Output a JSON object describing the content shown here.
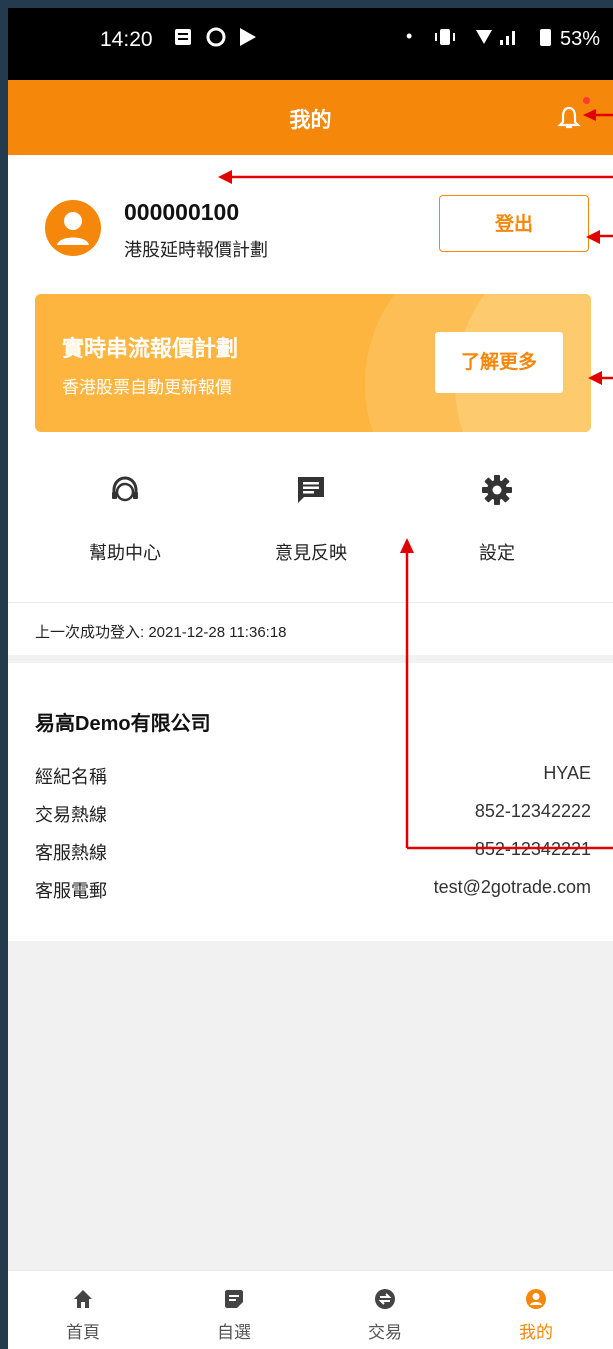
{
  "status_bar": {
    "time": "14:20",
    "battery": "53%"
  },
  "header": {
    "title": "我的"
  },
  "profile": {
    "user_id": "000000100",
    "plan": "港股延時報價計劃",
    "logout_label": "登出"
  },
  "banner": {
    "title": "實時串流報價計劃",
    "subtitle": "香港股票自動更新報價",
    "button_label": "了解更多"
  },
  "shortcuts": [
    {
      "label": "幫助中心",
      "icon": "headset-icon"
    },
    {
      "label": "意見反映",
      "icon": "feedback-icon"
    },
    {
      "label": "設定",
      "icon": "gear-icon"
    }
  ],
  "last_login": "上一次成功登入: 2021-12-28 11:36:18",
  "company": {
    "name": "易高Demo有限公司",
    "rows": [
      {
        "key": "經紀名稱",
        "value": "HYAE"
      },
      {
        "key": "交易熱線",
        "value": "852-12342222"
      },
      {
        "key": "客服熱線",
        "value": "852-12342221"
      },
      {
        "key": "客服電郵",
        "value": "test@2gotrade.com"
      }
    ]
  },
  "bottom_nav": [
    {
      "label": "首頁",
      "icon": "home-icon"
    },
    {
      "label": "自選",
      "icon": "watchlist-icon"
    },
    {
      "label": "交易",
      "icon": "trade-icon"
    },
    {
      "label": "我的",
      "icon": "user-icon",
      "active": true
    }
  ],
  "colors": {
    "accent": "#f5870a",
    "banner": "#fdb540",
    "annotation": "#e00000"
  }
}
